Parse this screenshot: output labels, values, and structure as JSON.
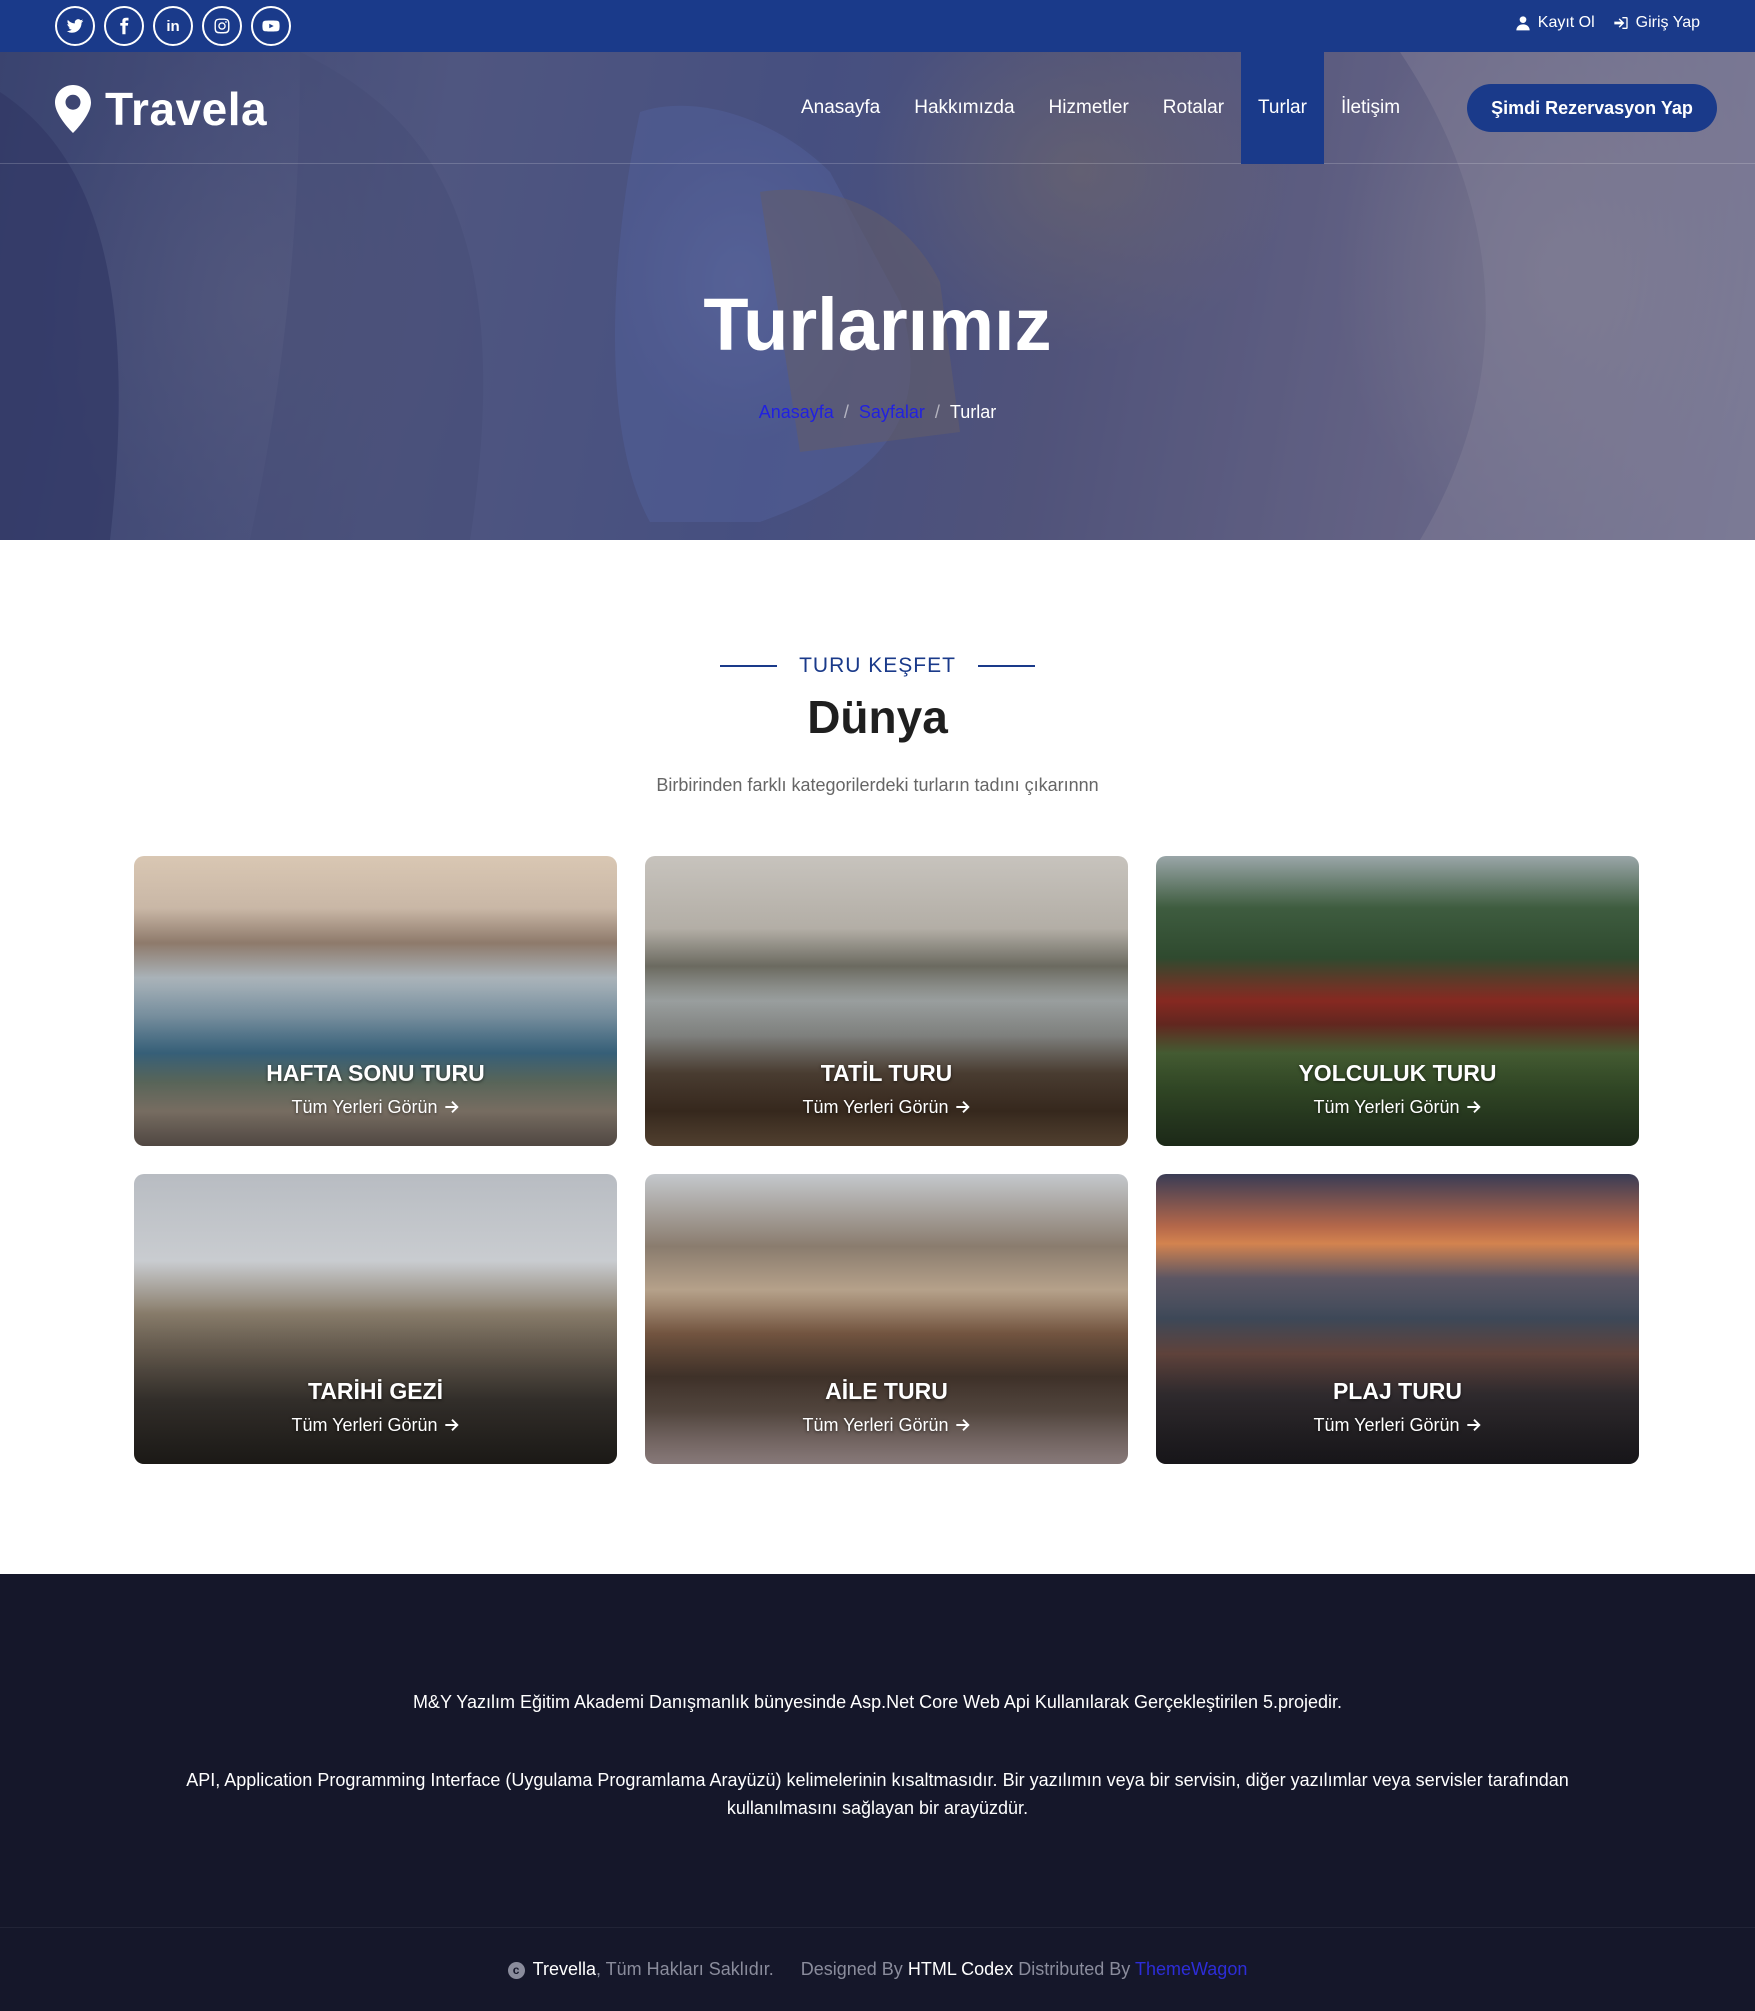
{
  "topbar": {
    "socials": [
      {
        "icon": "twitter-icon"
      },
      {
        "icon": "facebook-icon"
      },
      {
        "icon": "linkedin-icon",
        "label": "in"
      },
      {
        "icon": "instagram-icon"
      },
      {
        "icon": "youtube-icon"
      }
    ],
    "register_label": "Kayıt Ol",
    "login_label": "Giriş Yap"
  },
  "nav": {
    "brand": "Travela",
    "items": [
      {
        "label": "Anasayfa"
      },
      {
        "label": "Hakkımızda"
      },
      {
        "label": "Hizmetler"
      },
      {
        "label": "Rotalar"
      },
      {
        "label": "Turlar",
        "active": true
      },
      {
        "label": "İletişim"
      }
    ],
    "cta_label": "Şimdi Rezervasyon Yap"
  },
  "hero": {
    "title": "Turlarımız",
    "breadcrumb": [
      "Anasayfa",
      "Sayfalar",
      "Turlar"
    ]
  },
  "section": {
    "eyebrow": "TURU KEŞFET",
    "heading": "Dünya",
    "subtitle": "Birbirinden farklı kategorilerdeki turların tadını çıkarınnn"
  },
  "tours": [
    {
      "title": "HAFTA SONU TURU",
      "link": "Tüm Yerleri Görün"
    },
    {
      "title": "TATİL TURU",
      "link": "Tüm Yerleri Görün"
    },
    {
      "title": "YOLCULUK TURU",
      "link": "Tüm Yerleri Görün"
    },
    {
      "title": "TARİHİ GEZİ",
      "link": "Tüm Yerleri Görün"
    },
    {
      "title": "AİLE TURU",
      "link": "Tüm Yerleri Görün"
    },
    {
      "title": "PLAJ TURU",
      "link": "Tüm Yerleri Görün"
    }
  ],
  "footer": {
    "line1": "M&Y Yazılım Eğitim Akademi Danışmanlık bünyesinde Asp.Net Core Web Api Kullanılarak Gerçekleştirilen 5.projedir.",
    "line2": "API, Application Programming Interface (Uygulama Programlama Arayüzü) kelimelerinin kısaltmasıdır. Bir yazılımın veya bir servisin, diğer yazılımlar veya servisler tarafından kullanılmasını sağlayan bir arayüzdür.",
    "copyright": {
      "brand": "Trevella",
      "rights": ", Tüm Hakları Saklıdır.",
      "designed_by": "Designed By",
      "designer": "HTML Codex",
      "distributed_by": "Distributed By",
      "distributor": "ThemeWagon"
    }
  },
  "colors": {
    "brand_blue": "#1a3a8a",
    "footer_bg": "#15172a",
    "breadcrumb_link": "#2121e0"
  }
}
